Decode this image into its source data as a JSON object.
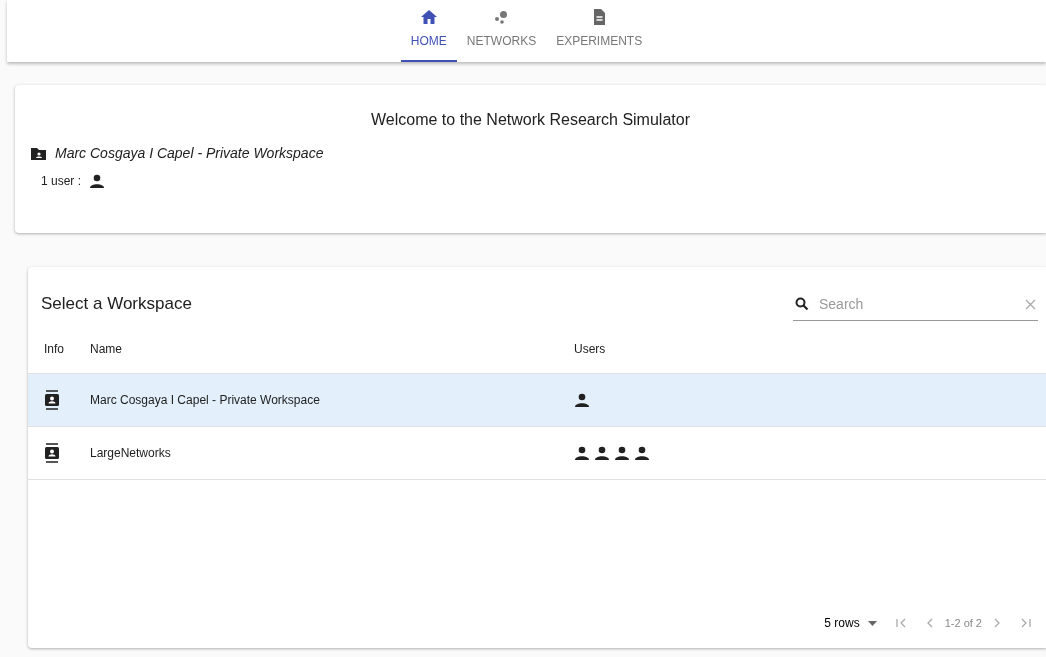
{
  "tabs": [
    {
      "label": "HOME",
      "kind": "home",
      "selected": true
    },
    {
      "label": "NETWORKS",
      "kind": "dots",
      "selected": false
    },
    {
      "label": "EXPERIMENTS",
      "kind": "file",
      "selected": false
    }
  ],
  "welcome": {
    "title": "Welcome to the Network Research Simulator",
    "workspace": "Marc Cosgaya I Capel - Private Workspace",
    "users_label": "1 user :",
    "users": [
      {
        "kind": "person"
      }
    ]
  },
  "workspaces": {
    "title": "Select a Workspace",
    "search": {
      "placeholder": "Search"
    },
    "columns": [
      "Info",
      "Name",
      "Users"
    ],
    "rows": [
      {
        "name": "Marc Cosgaya I Capel - Private Workspace",
        "selected": true,
        "users": [
          {
            "kind": "person"
          }
        ]
      },
      {
        "name": "LargeNetworks",
        "selected": false,
        "users": [
          {
            "kind": "person"
          },
          {
            "kind": "person"
          },
          {
            "kind": "person"
          },
          {
            "kind": "person"
          }
        ]
      }
    ],
    "pagination": {
      "rows_per_page": "5 rows",
      "range": "1-2 of 2"
    }
  }
}
